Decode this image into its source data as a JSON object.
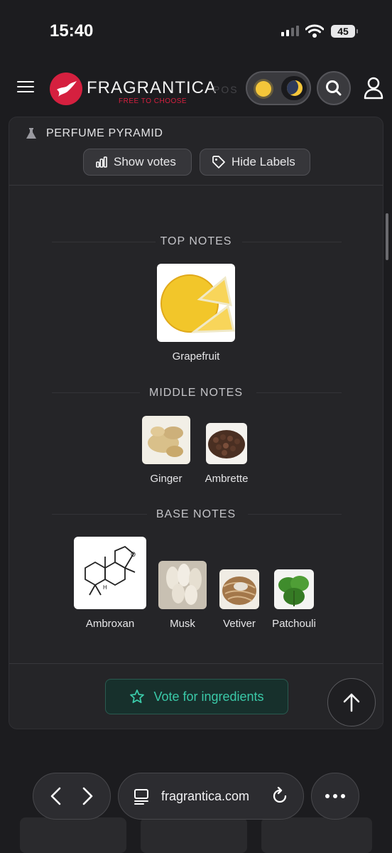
{
  "status": {
    "time": "15:40",
    "battery": "45"
  },
  "header": {
    "brand": "FRAGRANTICA",
    "tagline": "FREE TO CHOOSE",
    "ghost_text": "POS"
  },
  "pyramid": {
    "title": "PERFUME PYRAMID",
    "show_votes_label": "Show votes",
    "hide_labels_label": "Hide Labels",
    "top": {
      "title": "TOP NOTES",
      "notes": [
        {
          "name": "Grapefruit"
        }
      ]
    },
    "middle": {
      "title": "MIDDLE NOTES",
      "notes": [
        {
          "name": "Ginger"
        },
        {
          "name": "Ambrette"
        }
      ]
    },
    "base": {
      "title": "BASE NOTES",
      "notes": [
        {
          "name": "Ambroxan"
        },
        {
          "name": "Musk"
        },
        {
          "name": "Vetiver"
        },
        {
          "name": "Patchouli"
        }
      ]
    },
    "vote_label": "Vote for ingredients"
  },
  "browser": {
    "url": "fragrantica.com"
  },
  "colors": {
    "brand_red": "#d5203f",
    "accent_teal": "#3ac9a8",
    "background": "#1c1c1f",
    "panel": "#252528"
  }
}
